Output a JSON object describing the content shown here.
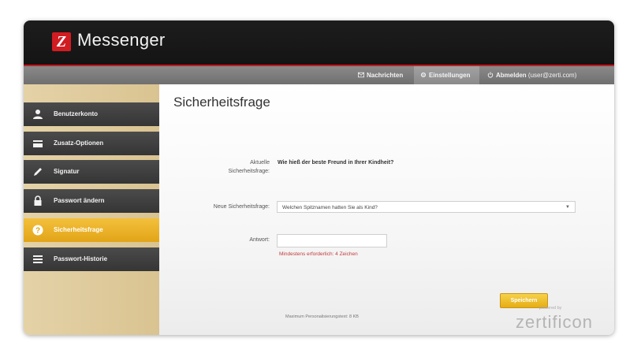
{
  "app": {
    "logo_letter": "Z",
    "title": "Messenger"
  },
  "topnav": {
    "news": "Nachrichten",
    "settings": "Einstellungen",
    "logout": "Abmelden",
    "user_email": "(user@zerti.com)"
  },
  "sidebar": {
    "items": [
      {
        "label": "Benutzerkonto",
        "icon": "user-icon"
      },
      {
        "label": "Zusatz-Optionen",
        "icon": "card-icon"
      },
      {
        "label": "Signatur",
        "icon": "pen-icon"
      },
      {
        "label": "Passwort ändern",
        "icon": "lock-icon"
      },
      {
        "label": "Sicherheitsfrage",
        "icon": "question-icon"
      },
      {
        "label": "Passwort-Historie",
        "icon": "list-icon"
      }
    ]
  },
  "main": {
    "title": "Sicherheitsfrage",
    "current_question_label_1": "Aktuelle",
    "current_question_label_2": "Sicherheitsfrage:",
    "current_question": "Wie hieß der beste Freund in Ihrer Kindheit?",
    "new_question_label": "Neue Sicherheitsfrage:",
    "new_question_selected": "Welchen Spitznamen hatten Sie als Kind?",
    "answer_label": "Antwort:",
    "answer_value": "",
    "hint": "Mindestens erforderlich: 4 Zeichen",
    "save_button": "Speichern"
  },
  "footer": {
    "text": "Maximum Personalisierungstext: 8 KB",
    "powered_by": "powered by",
    "brand": "zertificon"
  },
  "colors": {
    "accent_red": "#c41a1f",
    "active_yellow": "#e8ab1c",
    "sidebar_dark": "#3f3f3f",
    "sidebar_bg": "#ddc99a",
    "hint_red": "#c23b3b"
  }
}
